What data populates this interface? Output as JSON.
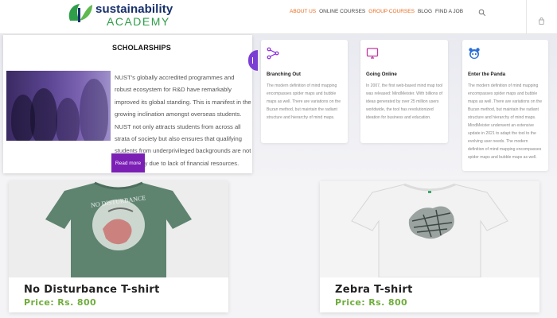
{
  "header": {
    "logo": {
      "line1": "sustainability",
      "line2": "ACADEMY"
    },
    "nav": [
      {
        "label": "ABOUT US",
        "accent": true
      },
      {
        "label": "ONLINE COURSES",
        "accent": false
      },
      {
        "label": "GROUP COURSES",
        "accent": true
      },
      {
        "label": "BLOG",
        "accent": false
      },
      {
        "label": "FIND A JOB",
        "accent": false
      }
    ],
    "icons": {
      "search": "search-icon",
      "cart": "cart-icon"
    }
  },
  "scholarships": {
    "title": "SCHOLARSHIPS",
    "body": "NUST's globally accredited programmes and robust ecosystem for R&D have remarkably improved its global standing. This is manifest in the growing inclination amongst overseas students. NUST not only attracts students from across all strata of society but also ensures that qualifying students from underprivileged backgrounds are not turned away due to lack of financial resources.",
    "button": "Read more"
  },
  "features": [
    {
      "icon": "branch-icon",
      "title": "Branching Out",
      "text": "The modern definition of mind mapping encompasses spider maps and bubble maps as well. There are variations on the Buzan method, but maintain the radiant structure and hierarchy of mind maps."
    },
    {
      "icon": "monitor-icon",
      "title": "Going Online",
      "text": "In 2007, the first web-based mind map tool was released: MindMeister. With billions of ideas generated by over 25 million users worldwide, the tool has revolutionized ideation for business and education."
    },
    {
      "icon": "panda-icon",
      "title": "Enter the Panda",
      "text": "The modern definition of mind mapping encompasses spider maps and bubble maps as well. There are variations on the Buzan method, but maintain the radiant structure and hierarchy of mind maps. MindMeister underwent an extensive update in 2021 to adapt the tool to the evolving user needs. The modern definition of mind mapping encompasses spider maps and bubble maps as well."
    }
  ],
  "products": [
    {
      "title": "No Disturbance T-shirt",
      "price": "Price: Rs. 800",
      "shirt_color": "#5e8470",
      "print_text": "NO DISTURBANCE"
    },
    {
      "title": "Zebra T-shirt",
      "price": "Price: Rs. 800",
      "shirt_color": "#f2f2f2",
      "print_text": ""
    }
  ],
  "colors": {
    "accent_orange": "#e86a1f",
    "brand_purple": "#7b1fb5",
    "price_green": "#6fae3d"
  }
}
